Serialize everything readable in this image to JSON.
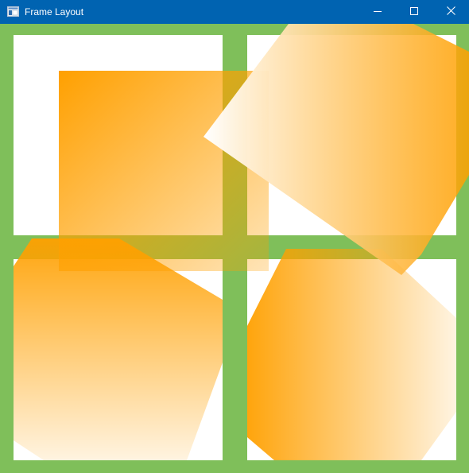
{
  "window": {
    "title": "Frame Layout"
  },
  "icons": {
    "app": "app-window-icon",
    "minimize": "minimize-icon",
    "maximize": "maximize-icon",
    "close": "close-icon"
  },
  "colors": {
    "titlebar": "#0063b1",
    "frame_green": "#7fbf5a",
    "shape_orange": "#ffa000",
    "shape_light": "#ffffff",
    "cell_background": "#ffffff"
  }
}
